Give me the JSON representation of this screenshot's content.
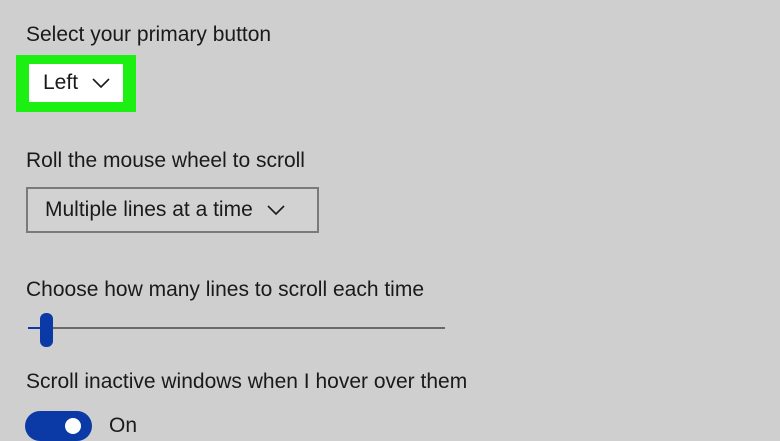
{
  "primary_button": {
    "label": "Select your primary button",
    "selected": "Left"
  },
  "mouse_wheel": {
    "label": "Roll the mouse wheel to scroll",
    "selected": "Multiple lines at a time"
  },
  "scroll_lines": {
    "label": "Choose how many lines to scroll each time",
    "value_fraction": 0.03
  },
  "inactive_scroll": {
    "label": "Scroll inactive windows when I hover over them",
    "state": "On"
  },
  "colors": {
    "accent": "#0b3aa6",
    "highlight": "#1cf012",
    "background": "#cfcfcf"
  },
  "icons": {
    "dropdown": "chevron-down-icon"
  }
}
